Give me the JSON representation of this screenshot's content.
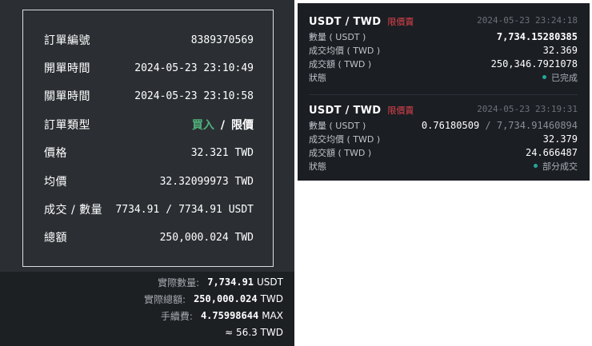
{
  "order_detail": {
    "rows": [
      {
        "label": "訂單編號",
        "value": "8389370569"
      },
      {
        "label": "開單時間",
        "value": "2024-05-23 23:10:49"
      },
      {
        "label": "關單時間",
        "value": "2024-05-23 23:10:58"
      },
      {
        "label": "訂單類型",
        "side": "買入",
        "type": "限價"
      },
      {
        "label": "價格",
        "value": "32.321 TWD"
      },
      {
        "label": "均價",
        "value": "32.32099973 TWD"
      },
      {
        "label": "成交 / 數量",
        "filled": "7734.91",
        "amount": "7734.91 USDT"
      },
      {
        "label": "總額",
        "value": "250,000.024 TWD"
      }
    ],
    "slash": "/"
  },
  "summary": {
    "actual_qty_label": "實際數量:",
    "actual_qty_value": "7,734.91",
    "actual_qty_unit": "USDT",
    "actual_total_label": "實際總額:",
    "actual_total_value": "250,000.024",
    "actual_total_unit": "TWD",
    "fee_label": "手續費:",
    "fee_value": "4.75998644",
    "fee_unit": "MAX",
    "approx": "≈ 56.3 TWD"
  },
  "orders": [
    {
      "pair": "USDT / TWD",
      "type": "限價賣",
      "time": "2024-05-23 23:24:18",
      "qty_label": "數量 ( USDT )",
      "qty_value": "7,734.15280385",
      "avg_label": "成交均價 ( TWD )",
      "avg_value": "32.369",
      "total_label": "成交額 ( TWD )",
      "total_value": "250,346.7921078",
      "status_label": "狀態",
      "status_value": "已完成"
    },
    {
      "pair": "USDT / TWD",
      "type": "限價賣",
      "time": "2024-05-23 23:19:31",
      "qty_label": "數量 ( USDT )",
      "qty_filled": "0.76180509",
      "qty_total": " / 7,734.91460894",
      "avg_label": "成交均價 ( TWD )",
      "avg_value": "32.379",
      "total_label": "成交額 ( TWD )",
      "total_value": "24.666487",
      "status_label": "狀態",
      "status_value": "部分成交"
    }
  ],
  "colors": {
    "buy_green": "#4fb07a",
    "sell_red": "#e0434c",
    "status_teal": "#26a69a"
  }
}
